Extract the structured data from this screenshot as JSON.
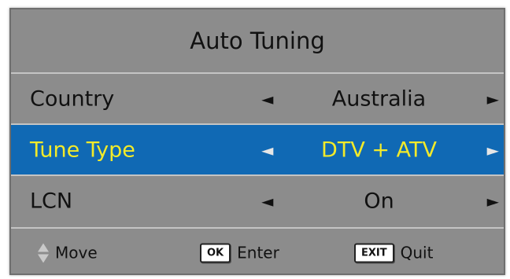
{
  "menu": {
    "title": "Auto Tuning",
    "rows": [
      {
        "label": "Country",
        "value": "Australia",
        "selected": false
      },
      {
        "label": "Tune Type",
        "value": "DTV + ATV",
        "selected": true
      },
      {
        "label": "LCN",
        "value": "On",
        "selected": false
      }
    ],
    "arrow_left": "◄",
    "arrow_right": "►"
  },
  "footer": {
    "move_label": "Move",
    "enter_key": "OK",
    "enter_label": "Enter",
    "exit_key": "EXIT",
    "quit_label": "Quit"
  },
  "colors": {
    "panel_bg": "#8c8c8c",
    "selected_bg": "#1069b4",
    "selected_text": "#f2ea2a",
    "text": "#111111"
  }
}
